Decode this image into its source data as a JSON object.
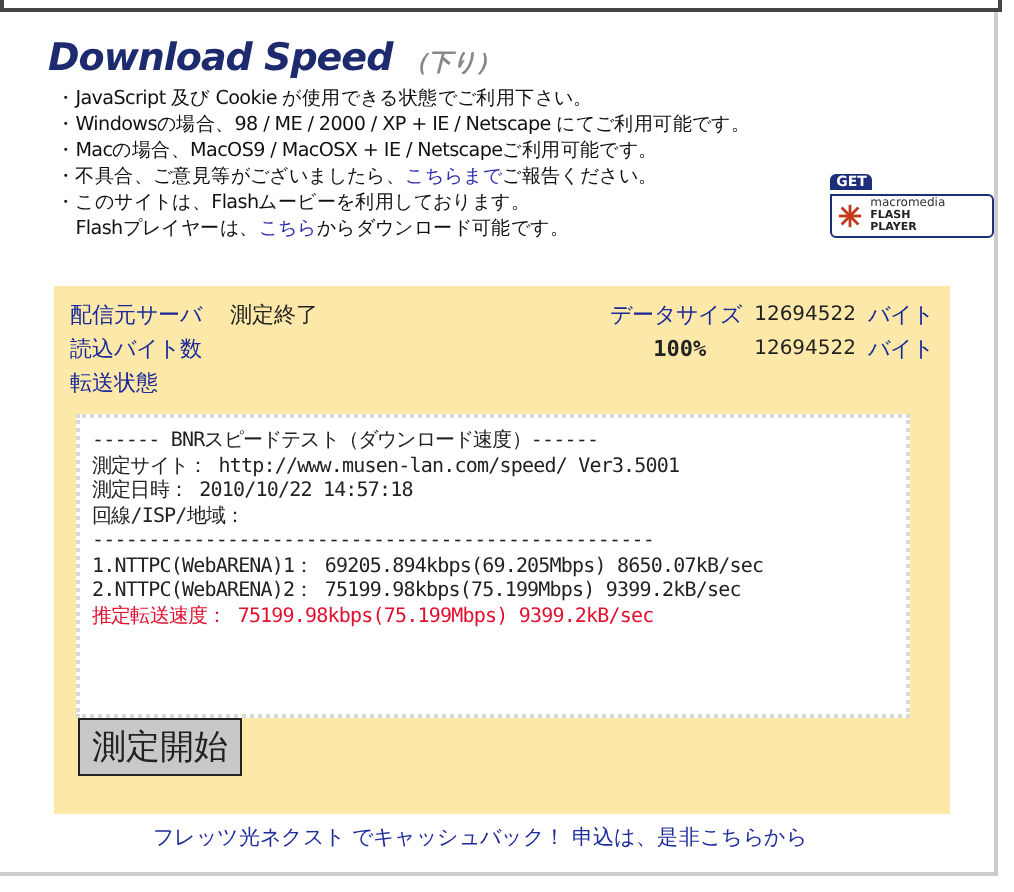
{
  "header": {
    "title": "Download Speed",
    "subtitle": "（下り）"
  },
  "notes": [
    {
      "parts": [
        {
          "text": "・JavaScript 及び Cookie が使用できる状態でご利用下さい。",
          "link": false
        }
      ]
    },
    {
      "parts": [
        {
          "text": "・Windowsの場合、98 / ME / 2000 / XP + IE / Netscape にてご利用可能です。",
          "link": false
        }
      ]
    },
    {
      "parts": [
        {
          "text": "・Macの場合、MacOS9 / MacOSX + IE / Netscapeご利用可能です。",
          "link": false
        }
      ]
    },
    {
      "parts": [
        {
          "text": "・不具合、ご意見等がございましたら、",
          "link": false
        },
        {
          "text": "こちらまで",
          "link": true
        },
        {
          "text": "ご報告ください。",
          "link": false
        }
      ]
    },
    {
      "parts": [
        {
          "text": "・このサイトは、Flashムービーを利用しております。",
          "link": false
        }
      ]
    },
    {
      "parts": [
        {
          "text": "　Flashプレイヤーは、",
          "link": false
        },
        {
          "text": "こちら",
          "link": true
        },
        {
          "text": "からダウンロード可能です。",
          "link": false
        }
      ]
    }
  ],
  "flash_badge": {
    "tag": "GET",
    "brand": "macromedia",
    "line1": "FLASH",
    "line2": "PLAYER"
  },
  "status": {
    "server_label": "配信元サーバ",
    "server_value": "測定終了",
    "size_label": "データサイズ",
    "size_value": "12694522",
    "size_unit": "バイト",
    "read_label": "読込バイト数",
    "percent": "100%",
    "read_value": "12694522",
    "read_unit": "バイト",
    "transfer_label": "転送状態"
  },
  "result_lines": [
    {
      "text": "------ BNRスピードテスト（ダウンロード速度）------",
      "kind": "normal"
    },
    {
      "text": "測定サイト： http://www.musen-lan.com/speed/ Ver3.5001",
      "kind": "normal"
    },
    {
      "text": "測定日時： 2010/10/22 14:57:18",
      "kind": "normal"
    },
    {
      "text": "回線/ISP/地域：",
      "kind": "normal"
    },
    {
      "text": "--------------------------------------------------",
      "kind": "normal"
    },
    {
      "text": "1.NTTPC(WebARENA)1： 69205.894kbps(69.205Mbps) 8650.07kB/sec",
      "kind": "normal"
    },
    {
      "text": "2.NTTPC(WebARENA)2： 75199.98kbps(75.199Mbps) 9399.2kB/sec",
      "kind": "normal"
    },
    {
      "text": "推定転送速度： 75199.98kbps(75.199Mbps) 9399.2kB/sec",
      "kind": "estimate"
    }
  ],
  "start_button": "測定開始",
  "promo_link": "フレッツ光ネクスト でキャッシュバック！ 申込は、是非こちらから"
}
